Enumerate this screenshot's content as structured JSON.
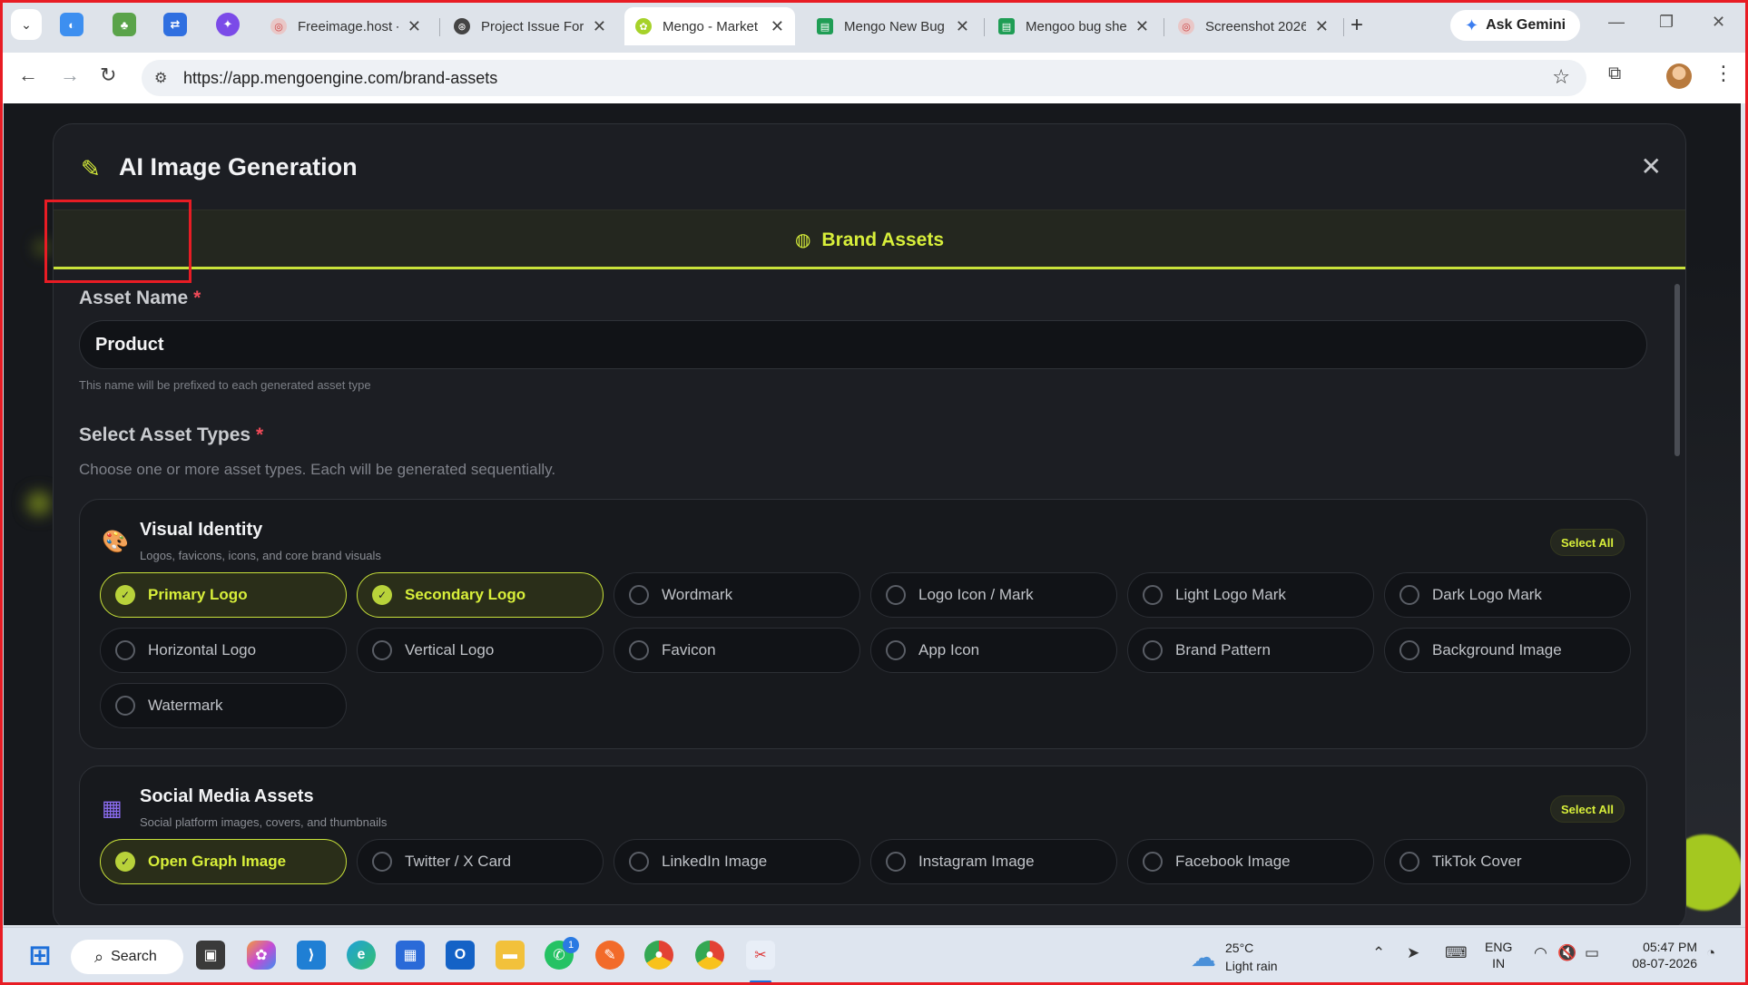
{
  "browser": {
    "tabs": [
      {
        "title": "Freeimage.host -",
        "active": false
      },
      {
        "title": "Project Issue For",
        "active": false
      },
      {
        "title": "Mengo - Market",
        "active": true
      },
      {
        "title": "Mengo New Bug",
        "active": false
      },
      {
        "title": "Mengoo bug she",
        "active": false
      },
      {
        "title": "Screenshot 2026",
        "active": false
      }
    ],
    "ask_gemini": "Ask Gemini",
    "url": "https://app.mengoengine.com/brand-assets"
  },
  "modal": {
    "title": "AI Image Generation",
    "tab_label": "Brand Assets",
    "asset_name_label": "Asset Name",
    "required_mark": "*",
    "asset_name_value": "Product",
    "asset_name_hint": "This name will be prefixed to each generated asset type",
    "asset_types_label": "Select Asset Types",
    "asset_types_sub": "Choose one or more asset types. Each will be generated sequentially.",
    "groups": [
      {
        "title": "Visual Identity",
        "desc": "Logos, favicons, icons, and core brand visuals",
        "select_all": "Select All",
        "items": [
          {
            "label": "Primary Logo",
            "selected": true
          },
          {
            "label": "Secondary Logo",
            "selected": true
          },
          {
            "label": "Wordmark",
            "selected": false
          },
          {
            "label": "Logo Icon / Mark",
            "selected": false
          },
          {
            "label": "Light Logo Mark",
            "selected": false
          },
          {
            "label": "Dark Logo Mark",
            "selected": false
          },
          {
            "label": "Horizontal Logo",
            "selected": false
          },
          {
            "label": "Vertical Logo",
            "selected": false
          },
          {
            "label": "Favicon",
            "selected": false
          },
          {
            "label": "App Icon",
            "selected": false
          },
          {
            "label": "Brand Pattern",
            "selected": false
          },
          {
            "label": "Background Image",
            "selected": false
          },
          {
            "label": "Watermark",
            "selected": false
          }
        ]
      },
      {
        "title": "Social Media Assets",
        "desc": "Social platform images, covers, and thumbnails",
        "select_all": "Select All",
        "items": [
          {
            "label": "Open Graph Image",
            "selected": true
          },
          {
            "label": "Twitter / X Card",
            "selected": false
          },
          {
            "label": "LinkedIn Image",
            "selected": false
          },
          {
            "label": "Instagram Image",
            "selected": false
          },
          {
            "label": "Facebook Image",
            "selected": false
          },
          {
            "label": "TikTok Cover",
            "selected": false
          }
        ]
      }
    ]
  },
  "taskbar": {
    "search": "Search",
    "whatsapp_badge": "1",
    "weather_temp": "25°C",
    "weather_desc": "Light rain",
    "lang_top": "ENG",
    "lang_bottom": "IN",
    "time": "05:47 PM",
    "date": "08-07-2026"
  },
  "colors": {
    "accent": "#d8ef3a",
    "modal_bg": "#1c1e23",
    "required": "#f04a58",
    "annotation": "#e81c24"
  }
}
